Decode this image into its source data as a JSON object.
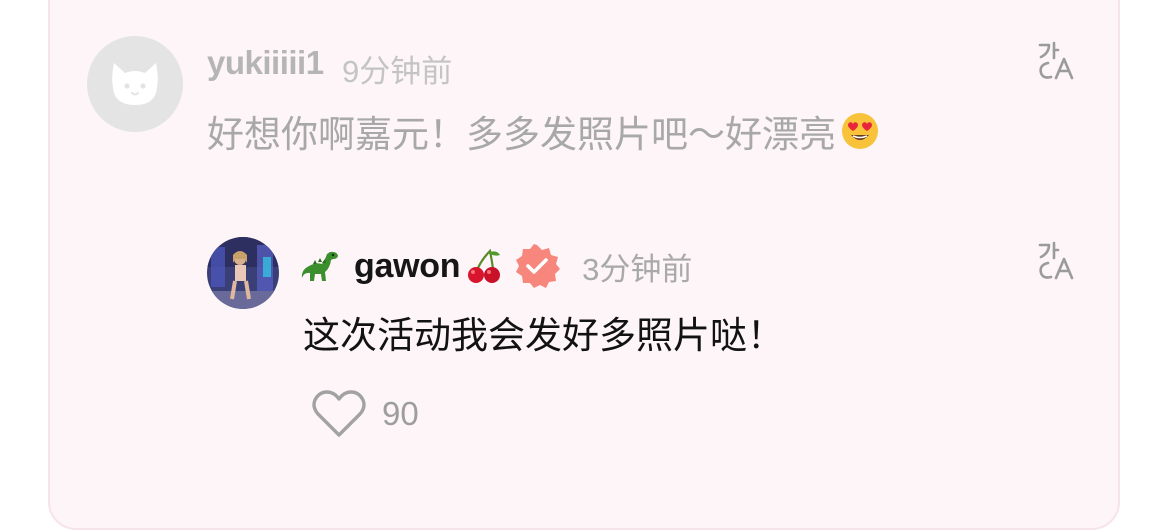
{
  "comment": {
    "username": "yukiiiii1",
    "time": "9分钟前",
    "text": "好想你啊嘉元！多多发照片吧～好漂亮",
    "emoji": "heart-eyes-emoji"
  },
  "reply": {
    "username": "gawon",
    "username_prefix_emoji": "dinosaur-emoji",
    "username_suffix_emoji": "cherries-emoji",
    "verified_badge": "verified-badge-icon",
    "time": "3分钟前",
    "text": "这次活动我会发好多照片哒！",
    "likes": "90"
  },
  "icons": {
    "translate": "translate-icon",
    "like": "heart-outline-icon",
    "default_avatar": "cat-avatar-icon"
  },
  "colors": {
    "card_background": "#fdf5f7",
    "verified_badge": "#f7867c",
    "muted_text": "#a8a8a8",
    "primary_text": "#121212"
  }
}
